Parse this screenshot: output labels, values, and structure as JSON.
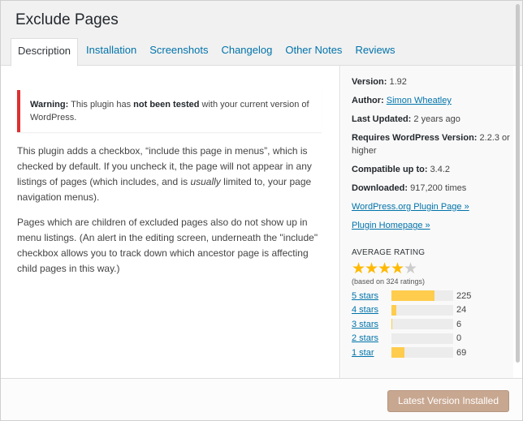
{
  "header": {
    "title": "Exclude Pages",
    "tabs": [
      {
        "label": "Description",
        "active": true
      },
      {
        "label": "Installation"
      },
      {
        "label": "Screenshots"
      },
      {
        "label": "Changelog"
      },
      {
        "label": "Other Notes"
      },
      {
        "label": "Reviews"
      }
    ]
  },
  "notice": {
    "strong_label": "Warning:",
    "text_1": " This plugin has ",
    "strong_2": "not been tested",
    "text_2": " with your current version of WordPress."
  },
  "description": {
    "p1_before": "This plugin adds a checkbox, “include this page in menus”, which is checked by default. If you uncheck it, the page will not appear in any listings of pages (which includes, and is ",
    "p1_em": "usually",
    "p1_after": " limited to, your page navigation menus).",
    "p2": "Pages which are children of excluded pages also do not show up in menu listings. (An alert in the editing screen, underneath the \"include\" checkbox allows you to track down which ancestor page is affecting child pages in this way.)"
  },
  "sidebar": {
    "version_label": "Version:",
    "version": "1.92",
    "author_label": "Author:",
    "author": "Simon Wheatley",
    "updated_label": "Last Updated:",
    "updated": "2 years ago",
    "requires_label": "Requires WordPress Version:",
    "requires": "2.2.3 or higher",
    "compatible_label": "Compatible up to:",
    "compatible": "3.4.2",
    "downloaded_label": "Downloaded:",
    "downloaded": "917,200 times",
    "plugin_page_link": "WordPress.org Plugin Page »",
    "homepage_link": "Plugin Homepage »",
    "average_rating_title": "AVERAGE RATING",
    "star_icon": "star-icon",
    "stars_filled": 4,
    "based_on": "(based on 324 ratings)",
    "ratings": [
      {
        "label": "5 stars",
        "count": "225",
        "fraction": 0.694
      },
      {
        "label": "4 stars",
        "count": "24",
        "fraction": 0.074
      },
      {
        "label": "3 stars",
        "count": "6",
        "fraction": 0.019
      },
      {
        "label": "2 stars",
        "count": "0",
        "fraction": 0.0
      },
      {
        "label": "1 star",
        "count": "69",
        "fraction": 0.213
      }
    ]
  },
  "footer": {
    "install_button": "Latest Version Installed"
  },
  "colors": {
    "accent_link": "#0073aa",
    "warning_border": "#dc3232",
    "star": "#ffb900",
    "rating_fill": "#ffcc4d",
    "disabled_button": "#c8a790"
  }
}
